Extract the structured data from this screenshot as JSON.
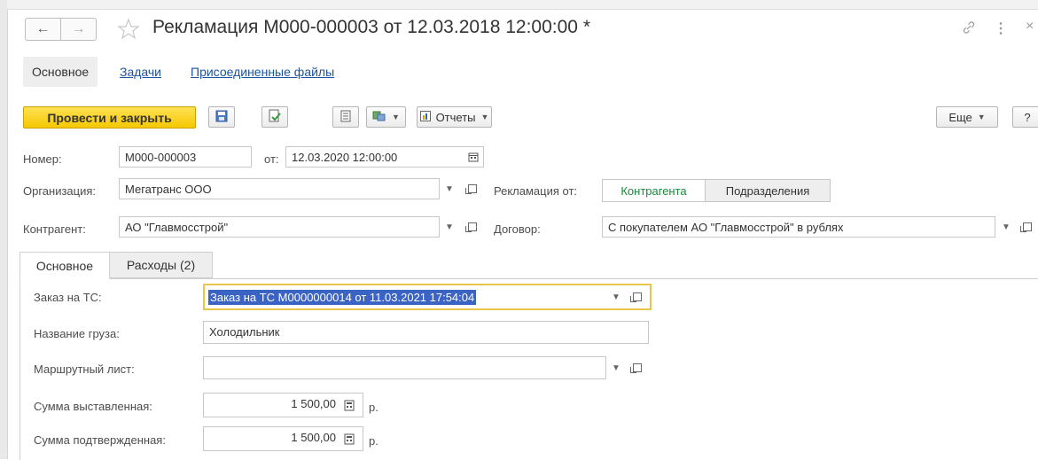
{
  "header": {
    "title": "Рекламация М000-000003 от 12.03.2018 12:00:00 *",
    "back_icon": "arrow-left",
    "forward_icon": "arrow-right",
    "favorite_icon": "star",
    "link_icon": "link",
    "more_icon": "vertical-dots",
    "close_label": "×"
  },
  "nav_tabs": [
    {
      "label": "Основное"
    },
    {
      "label": "Задачи"
    },
    {
      "label": "Присоединенные файлы"
    }
  ],
  "toolbar": {
    "post_close_label": "Провести и закрыть",
    "reports_label": "Отчеты",
    "more_label": "Еще",
    "help_label": "?"
  },
  "form": {
    "number_label": "Номер:",
    "number_value": "М000-000003",
    "date_label": "от:",
    "date_value": "12.03.2020 12:00:00",
    "org_label": "Организация:",
    "org_value": "Мегатранс ООО",
    "claim_from_label": "Рекламация от:",
    "claim_from_options": [
      "Контрагента",
      "Подразделения"
    ],
    "counterparty_label": "Контрагент:",
    "counterparty_value": "АО \"Главмосстрой\"",
    "contract_label": "Договор:",
    "contract_value": "С покупателем АО \"Главмосстрой\" в рублях"
  },
  "tabs": [
    {
      "label": "Основное"
    },
    {
      "label": "Расходы (2)"
    }
  ],
  "details": {
    "order_label": "Заказ на ТС:",
    "order_value": "Заказ на ТС М0000000014 от 11.03.2021 17:54:04",
    "cargo_label": "Название груза:",
    "cargo_value": "Холодильник",
    "route_label": "Маршрутный лист:",
    "route_value": "",
    "amount_billed_label": "Сумма выставленная:",
    "amount_billed_value": "1 500,00",
    "amount_confirmed_label": "Сумма подтвержденная:",
    "amount_confirmed_value": "1 500,00",
    "currency": "р."
  },
  "colors": {
    "primary_button": "#f5c800",
    "link": "#1a53a0",
    "active_toggle_text": "#1a8a3a",
    "selection": "#3b63c4",
    "focus_border": "#e8c64a"
  }
}
